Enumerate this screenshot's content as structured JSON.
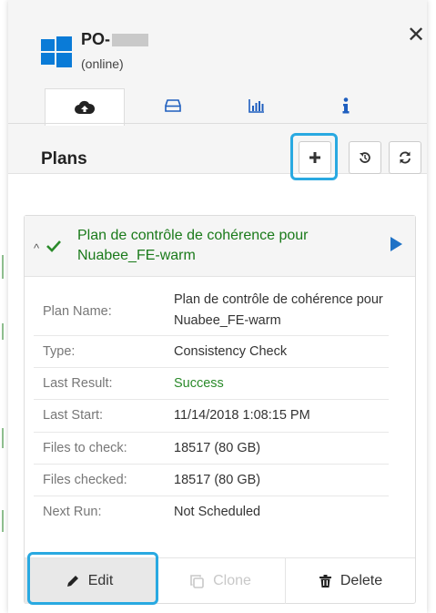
{
  "device": {
    "name": "PO-",
    "status": "(online)"
  },
  "tabs": [
    {
      "icon": "cloud-upload-icon",
      "active": true
    },
    {
      "icon": "hard-drive-icon",
      "active": false
    },
    {
      "icon": "bar-chart-icon",
      "active": false
    },
    {
      "icon": "info-icon",
      "active": false
    }
  ],
  "plans": {
    "title": "Plans",
    "toolbar": {
      "add_icon": "plus-icon",
      "history_icon": "history-icon",
      "refresh_icon": "refresh-icon"
    },
    "card": {
      "title": "Plan de contrôle de cohérence pour Nuabee_FE-warm",
      "status_color": "#2a8a2a",
      "details": [
        {
          "label": "Plan Name:",
          "value": "Plan de contrôle de cohérence pour Nuabee_FE-warm"
        },
        {
          "label": "Type:",
          "value": "Consistency Check"
        },
        {
          "label": "Last Result:",
          "value": "Success"
        },
        {
          "label": "Last Start:",
          "value": "11/14/2018 1:08:15 PM"
        },
        {
          "label": "Files to check:",
          "value": "18517 (80 GB)"
        },
        {
          "label": "Files checked:",
          "value": "18517 (80 GB)"
        },
        {
          "label": "Next Run:",
          "value": "Not Scheduled"
        }
      ],
      "actions": {
        "edit": "Edit",
        "clone": "Clone",
        "delete": "Delete"
      }
    }
  },
  "colors": {
    "accent": "#0a7bd7",
    "highlight": "#29a9e1",
    "success": "#2a8a2a"
  }
}
